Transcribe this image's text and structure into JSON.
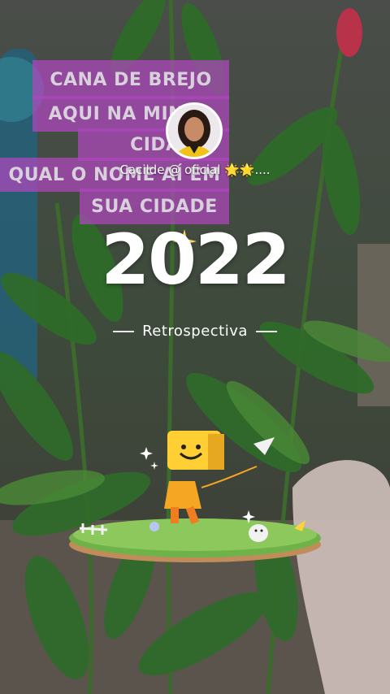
{
  "caption": {
    "lines": [
      "CANA DE BREJO",
      "AQUI NA MINHA",
      "CIDADE",
      "QUAL O NOME AÍ EM",
      "SUA CIDADE"
    ]
  },
  "profile": {
    "handle": "Cacilde @ oficial 🌟🌟...."
  },
  "recap": {
    "year": "2022",
    "label": "Retrospectiva"
  },
  "colors": {
    "caption_bg": "#b046be",
    "text": "#ffffff",
    "mascot": "#f5a623"
  }
}
